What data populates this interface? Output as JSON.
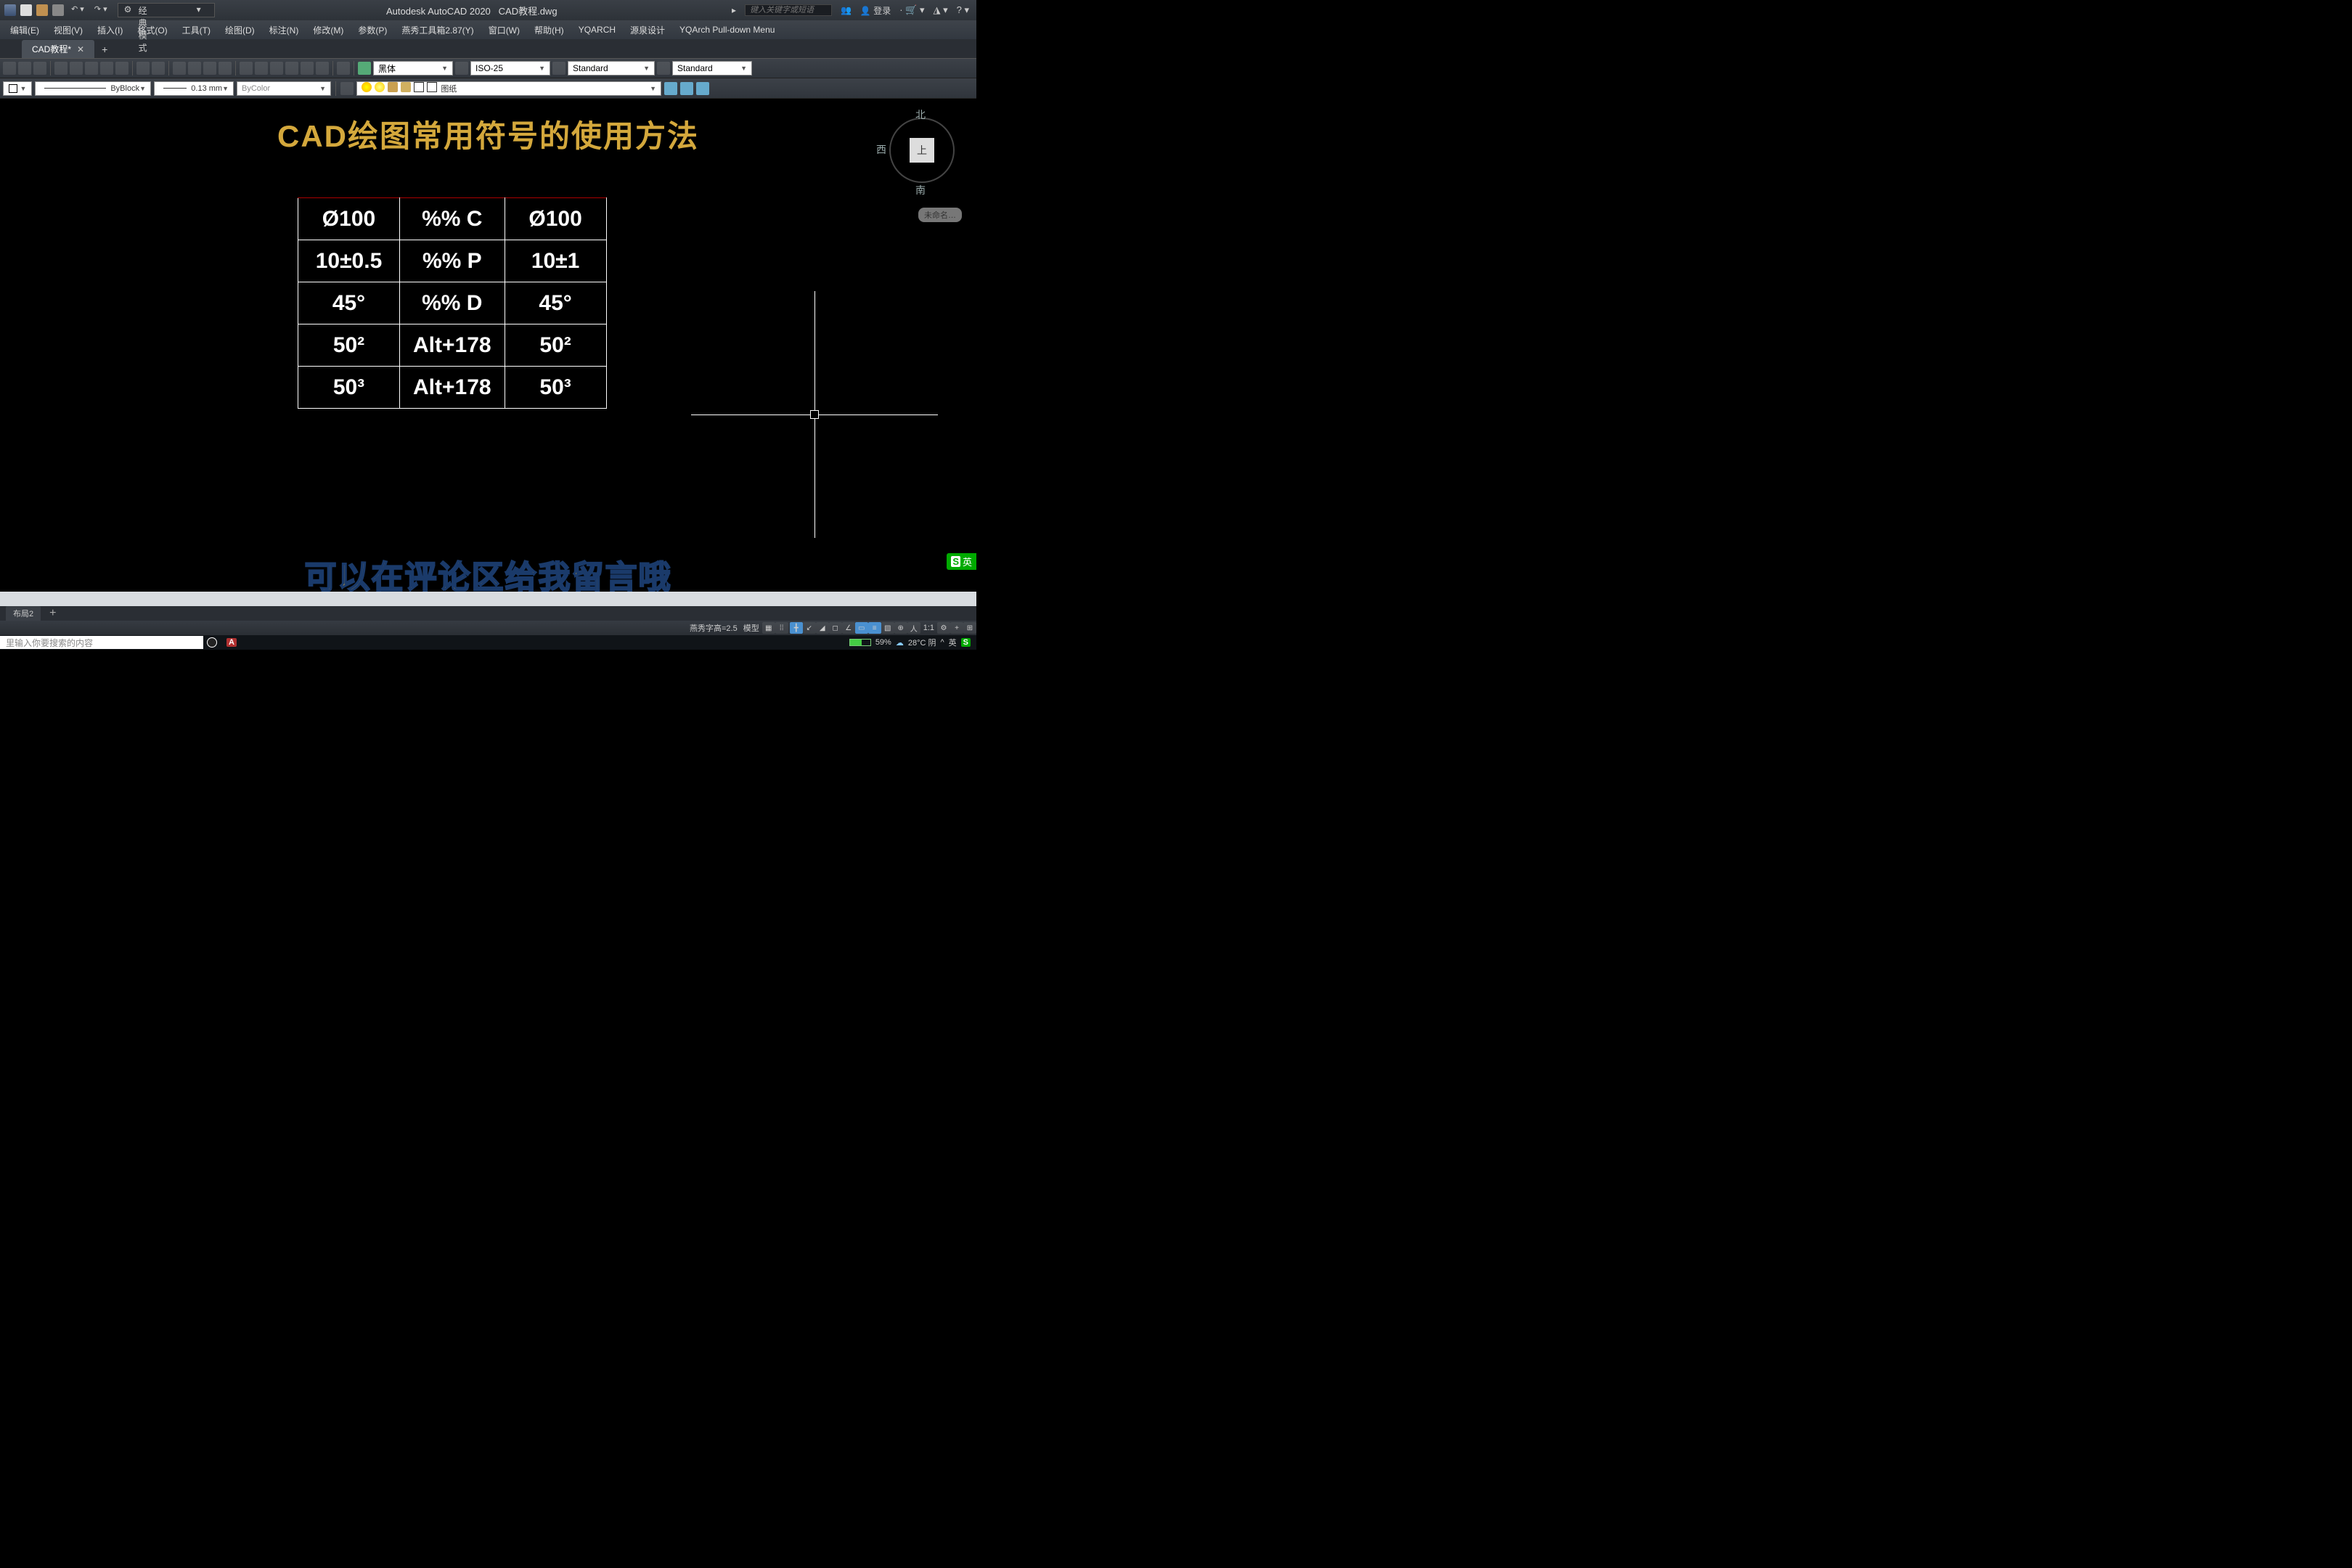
{
  "title": {
    "app": "Autodesk AutoCAD 2020",
    "file": "CAD教程.dwg"
  },
  "qat": {
    "workspace": "经典模式",
    "search_placeholder": "键入关键字或短语",
    "login": "登录"
  },
  "menu": {
    "items": [
      "编辑(E)",
      "视图(V)",
      "插入(I)",
      "格式(O)",
      "工具(T)",
      "绘图(D)",
      "标注(N)",
      "修改(M)",
      "参数(P)",
      "燕秀工具箱2.87(Y)",
      "窗口(W)",
      "帮助(H)",
      "YQARCH",
      "源泉设计",
      "YQArch Pull-down Menu"
    ]
  },
  "tab": {
    "name": "CAD教程*"
  },
  "toolbar": {
    "font": "黑体",
    "dimstyle": "ISO-25",
    "textstyle": "Standard",
    "tablestyle": "Standard"
  },
  "props": {
    "layer": "图纸",
    "linetype": "ByBlock",
    "lineweight": "0.13 mm",
    "color": "ByColor"
  },
  "canvas": {
    "heading": "CAD绘图常用符号的使用方法",
    "caption": "可以在评论区给我留言哦",
    "table": [
      {
        "a": "Ø100",
        "b": "%% C",
        "c": "Ø100"
      },
      {
        "a": "10±0.5",
        "b": "%% P",
        "c": "10±1"
      },
      {
        "a": "45°",
        "b": "%% D",
        "c": "45°"
      },
      {
        "a": "50²",
        "b": "Alt+178",
        "c": "50²"
      },
      {
        "a": "50³",
        "b": "Alt+178",
        "c": "50³"
      }
    ],
    "viewcube": {
      "top": "上",
      "n": "北",
      "w": "西",
      "s": "南"
    },
    "unnamed": "未命名…",
    "ime": "英"
  },
  "layout": {
    "tab": "布局2"
  },
  "status": {
    "yanxiu": "燕秀字高=2.5",
    "space": "模型",
    "scale": "1:1"
  },
  "taskbar": {
    "search": "里输入你要搜索的内容",
    "battery": "59%",
    "weather": "28°C 阴",
    "ime_lang": "英"
  }
}
